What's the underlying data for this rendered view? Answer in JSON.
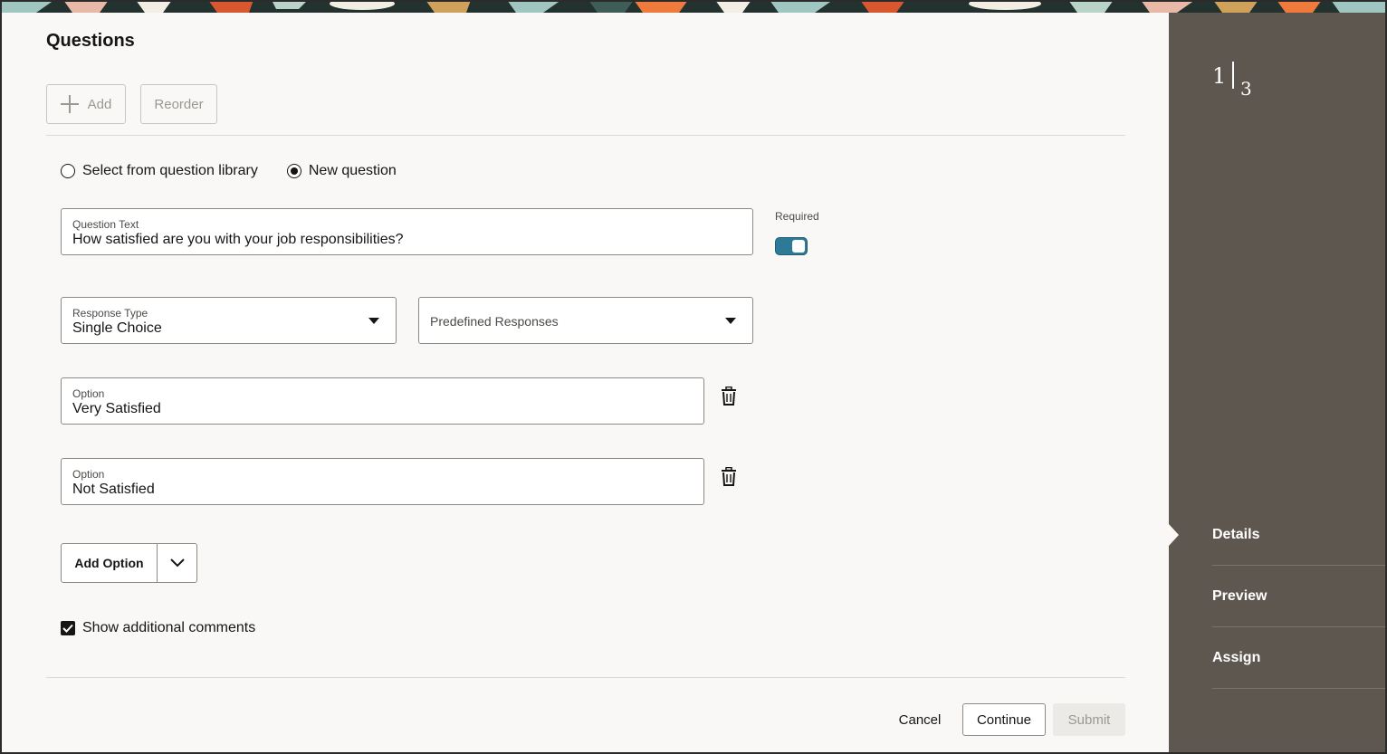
{
  "page": {
    "title": "Questions"
  },
  "toolbar": {
    "add_label": "Add",
    "reorder_label": "Reorder"
  },
  "question_source": {
    "options": [
      "Select from question library",
      "New question"
    ],
    "selected": "New question"
  },
  "question_text": {
    "label": "Question Text",
    "value": "How satisfied are you with your job responsibilities?"
  },
  "required": {
    "label": "Required",
    "on": true
  },
  "response_type": {
    "label": "Response Type",
    "value": "Single Choice"
  },
  "predefined_responses": {
    "placeholder": "Predefined Responses"
  },
  "options": [
    {
      "label": "Option",
      "value": "Very Satisfied"
    },
    {
      "label": "Option",
      "value": "Not Satisfied"
    }
  ],
  "add_option": {
    "label": "Add Option"
  },
  "show_comments": {
    "label": "Show additional comments",
    "checked": true
  },
  "footer": {
    "cancel_label": "Cancel",
    "continue_label": "Continue",
    "submit_label": "Submit"
  },
  "train": {
    "current": "1",
    "total": "3",
    "steps": [
      {
        "label": "Details",
        "active": true
      },
      {
        "label": "Preview",
        "active": false
      },
      {
        "label": "Assign",
        "active": false
      }
    ]
  },
  "colors": {
    "toggle_on": "#2e7a96",
    "sidebar_bg": "#5e574f",
    "page_bg": "#f9f8f6"
  }
}
